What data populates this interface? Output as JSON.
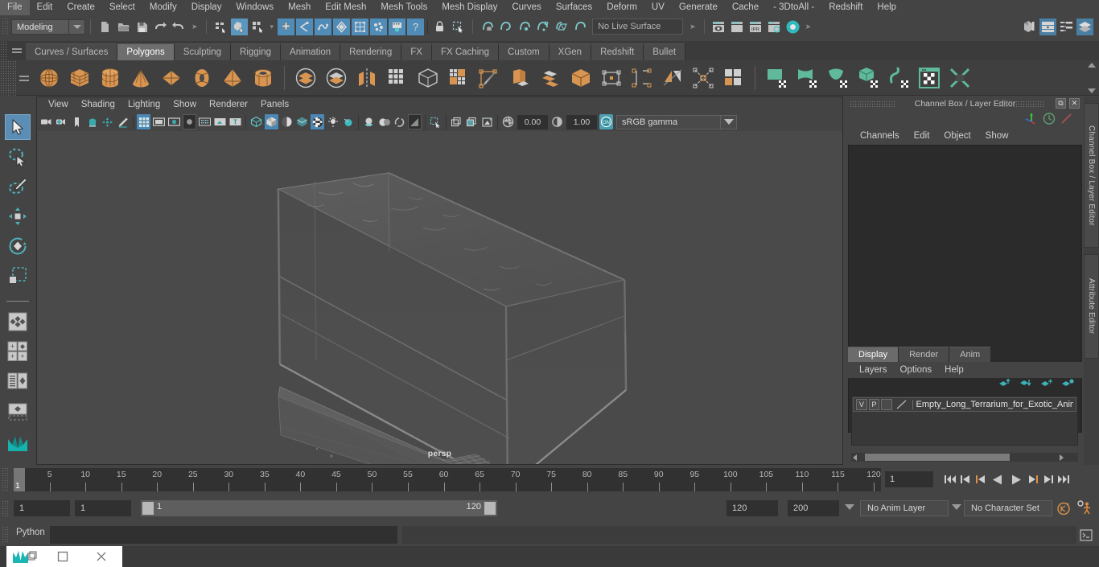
{
  "app": {
    "title": "Autodesk Maya",
    "menu_set": "Modeling"
  },
  "menubar": {
    "items": [
      "File",
      "Edit",
      "Create",
      "Select",
      "Modify",
      "Display",
      "Windows",
      "Mesh",
      "Edit Mesh",
      "Mesh Tools",
      "Mesh Display",
      "Curves",
      "Surfaces",
      "Deform",
      "UV",
      "Generate",
      "Cache",
      "- 3DtoAll -",
      "Redshift",
      "Help"
    ]
  },
  "statusline": {
    "menu_set_value": "Modeling",
    "live_surface": "No Live Surface",
    "icons": [
      "new-scene-icon",
      "open-scene-icon",
      "save-scene-icon",
      "undo-icon",
      "redo-icon",
      "select-by-hierarchy-icon",
      "select-by-object-icon",
      "select-by-component-icon",
      "mask-add-icon",
      "mask-curve-icon",
      "mask-surface-icon",
      "mask-deform-icon",
      "mask-lattice-icon",
      "mask-particle-icon",
      "mask-joint-icon",
      "mask-misc-icon",
      "lock-icon",
      "marquee-select-icon",
      "snap-grid-icon",
      "snap-curve-icon",
      "snap-point-icon",
      "snap-projected-icon",
      "snap-view-plane-icon",
      "snap-live-icon",
      "render-current-frame-icon",
      "render-sequence-icon",
      "ipr-render-icon",
      "render-settings-icon",
      "hypershade-icon",
      "show-editor-icon",
      "outliner-icon",
      "node-editor-icon",
      "layer-editor-icon"
    ]
  },
  "shelf": {
    "tabs": [
      "Curves / Surfaces",
      "Polygons",
      "Sculpting",
      "Rigging",
      "Animation",
      "Rendering",
      "FX",
      "FX Caching",
      "Custom",
      "XGen",
      "Redshift",
      "Bullet"
    ],
    "active_tab": "Polygons",
    "icons": [
      "poly-sphere-icon",
      "poly-cube-icon",
      "poly-cylinder-icon",
      "poly-cone-icon",
      "poly-plane-icon",
      "poly-torus-icon",
      "poly-pyramid-icon",
      "poly-pipe-icon",
      "boolean-union-icon",
      "boolean-difference-icon",
      "boolean-intersection-icon",
      "mirror-icon",
      "multi-cut-icon",
      "bevel-icon",
      "smooth-icon",
      "extrude-icon",
      "combine-icon",
      "separate-icon",
      "target-weld-icon",
      "quad-draw-icon",
      "insert-edge-loop-icon",
      "append-polygon-icon",
      "transfer-attributes-icon",
      "remesh-icon",
      "uv-editor-icon",
      "unfold-uv-icon",
      "planar-map-icon",
      "automatic-map-icon",
      "uv-cut-icon",
      "uv-layout-icon",
      "uv-snapshot-icon"
    ]
  },
  "toolbox": {
    "tools": [
      "select-tool",
      "lasso-select-tool",
      "paint-select-tool",
      "move-tool",
      "rotate-tool",
      "scale-tool",
      "last-tool-used",
      "quick-layout-single-icon",
      "quick-layout-four-icon",
      "quick-layout-outliner-icon",
      "quick-layout-persp-icon",
      "maya-logo-icon"
    ],
    "active": "select-tool"
  },
  "viewport": {
    "menu": [
      "View",
      "Shading",
      "Lighting",
      "Show",
      "Renderer",
      "Panels"
    ],
    "camera_label": "persp",
    "exposure": "0.00",
    "gamma": "1.00",
    "color_management": "sRGB gamma",
    "toolbar_icons": [
      "select-camera-icon",
      "camera-attributes-icon",
      "bookmark-icon",
      "image-plane-icon",
      "two-d-pan-zoom-icon",
      "grease-pencil-icon",
      "grid-toggle-icon",
      "film-gate-icon",
      "resolution-gate-icon",
      "gate-mask-icon",
      "field-chart-icon",
      "safe-action-icon",
      "safe-title-icon",
      "wireframe-icon",
      "smooth-shade-icon",
      "shaded-wireframe-icon",
      "hardware-texture-icon",
      "hardware-lighting-icon",
      "hardware-fog-icon",
      "screen-space-ao-icon",
      "motion-blur-icon",
      "multisample-icon",
      "depth-of-field-icon",
      "xray-icon",
      "xray-joints-icon",
      "xray-active-components-icon",
      "isolate-select-icon",
      "exposure-icon",
      "gamma-icon",
      "view-transform-icon"
    ]
  },
  "channelbox": {
    "panel_title": "Channel Box / Layer Editor",
    "menu": [
      "Channels",
      "Edit",
      "Object",
      "Show"
    ],
    "window_buttons": [
      "restore-icon",
      "close-icon"
    ],
    "quick_icons": [
      "move-axis-icon",
      "rotate-clock-icon",
      "scale-icon"
    ]
  },
  "layer_editor": {
    "tabs": [
      "Display",
      "Render",
      "Anim"
    ],
    "active_tab": "Display",
    "menu": [
      "Layers",
      "Options",
      "Help"
    ],
    "toolbar_icons": [
      "move-layer-up-icon",
      "move-layer-down-icon",
      "new-layer-icon",
      "new-layer-from-selected-icon"
    ],
    "layers": [
      {
        "visibility": "V",
        "playback": "P",
        "shading": "",
        "color_swatch": "#777777",
        "name": "Empty_Long_Terrarium_for_Exotic_Anim"
      }
    ]
  },
  "side_tabs": [
    "Channel Box / Layer Editor",
    "Attribute Editor"
  ],
  "timeline": {
    "start": 1,
    "end": 120,
    "current_frame": "1",
    "tick_labels": [
      5,
      10,
      15,
      20,
      25,
      30,
      35,
      40,
      45,
      50,
      55,
      60,
      65,
      70,
      75,
      80,
      85,
      90,
      95,
      100,
      105,
      110,
      115,
      120
    ],
    "playback_buttons": [
      "go-to-start-icon",
      "step-back-keyframe-icon",
      "step-back-frame-icon",
      "play-backwards-icon",
      "play-forwards-icon",
      "step-forward-frame-icon",
      "step-forward-keyframe-icon",
      "go-to-end-icon"
    ]
  },
  "range_slider": {
    "anim_start": "1",
    "range_start": "1",
    "range_slider_low": "1",
    "range_slider_high": "120",
    "range_end": "120",
    "anim_end": "200",
    "anim_layer": "No Anim Layer",
    "character_set": "No Character Set",
    "right_icons": [
      "auto-keyframe-icon",
      "animation-preferences-icon"
    ]
  },
  "command_line": {
    "language": "Python",
    "input_value": "",
    "output_value": "",
    "script_editor_icon": "script-editor-icon"
  },
  "taskbar": {
    "items": [
      "maya-app-icon",
      "restore-window-icon",
      "maximize-window-icon",
      "close-window-icon"
    ]
  }
}
